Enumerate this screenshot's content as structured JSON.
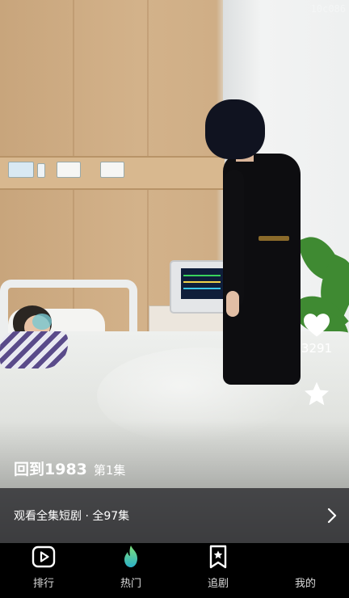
{
  "watermark": "10c086",
  "video": {
    "title": "回到1983",
    "episode": "第1集",
    "like_count": "3291"
  },
  "series_bar": {
    "text": "观看全集短剧 · 全97集"
  },
  "tabbar": {
    "tabs": [
      {
        "label": "排行",
        "icon": "play-rank-icon"
      },
      {
        "label": "热门",
        "icon": "flame-icon",
        "active": true
      },
      {
        "label": "追剧",
        "icon": "bookmark-star-icon"
      },
      {
        "label": "我的",
        "icon": "profile-icon"
      }
    ]
  },
  "colors": {
    "flame_top": "#7ee07a",
    "flame_bottom": "#2bb0c8",
    "tab_label": "#dcdcdc"
  }
}
